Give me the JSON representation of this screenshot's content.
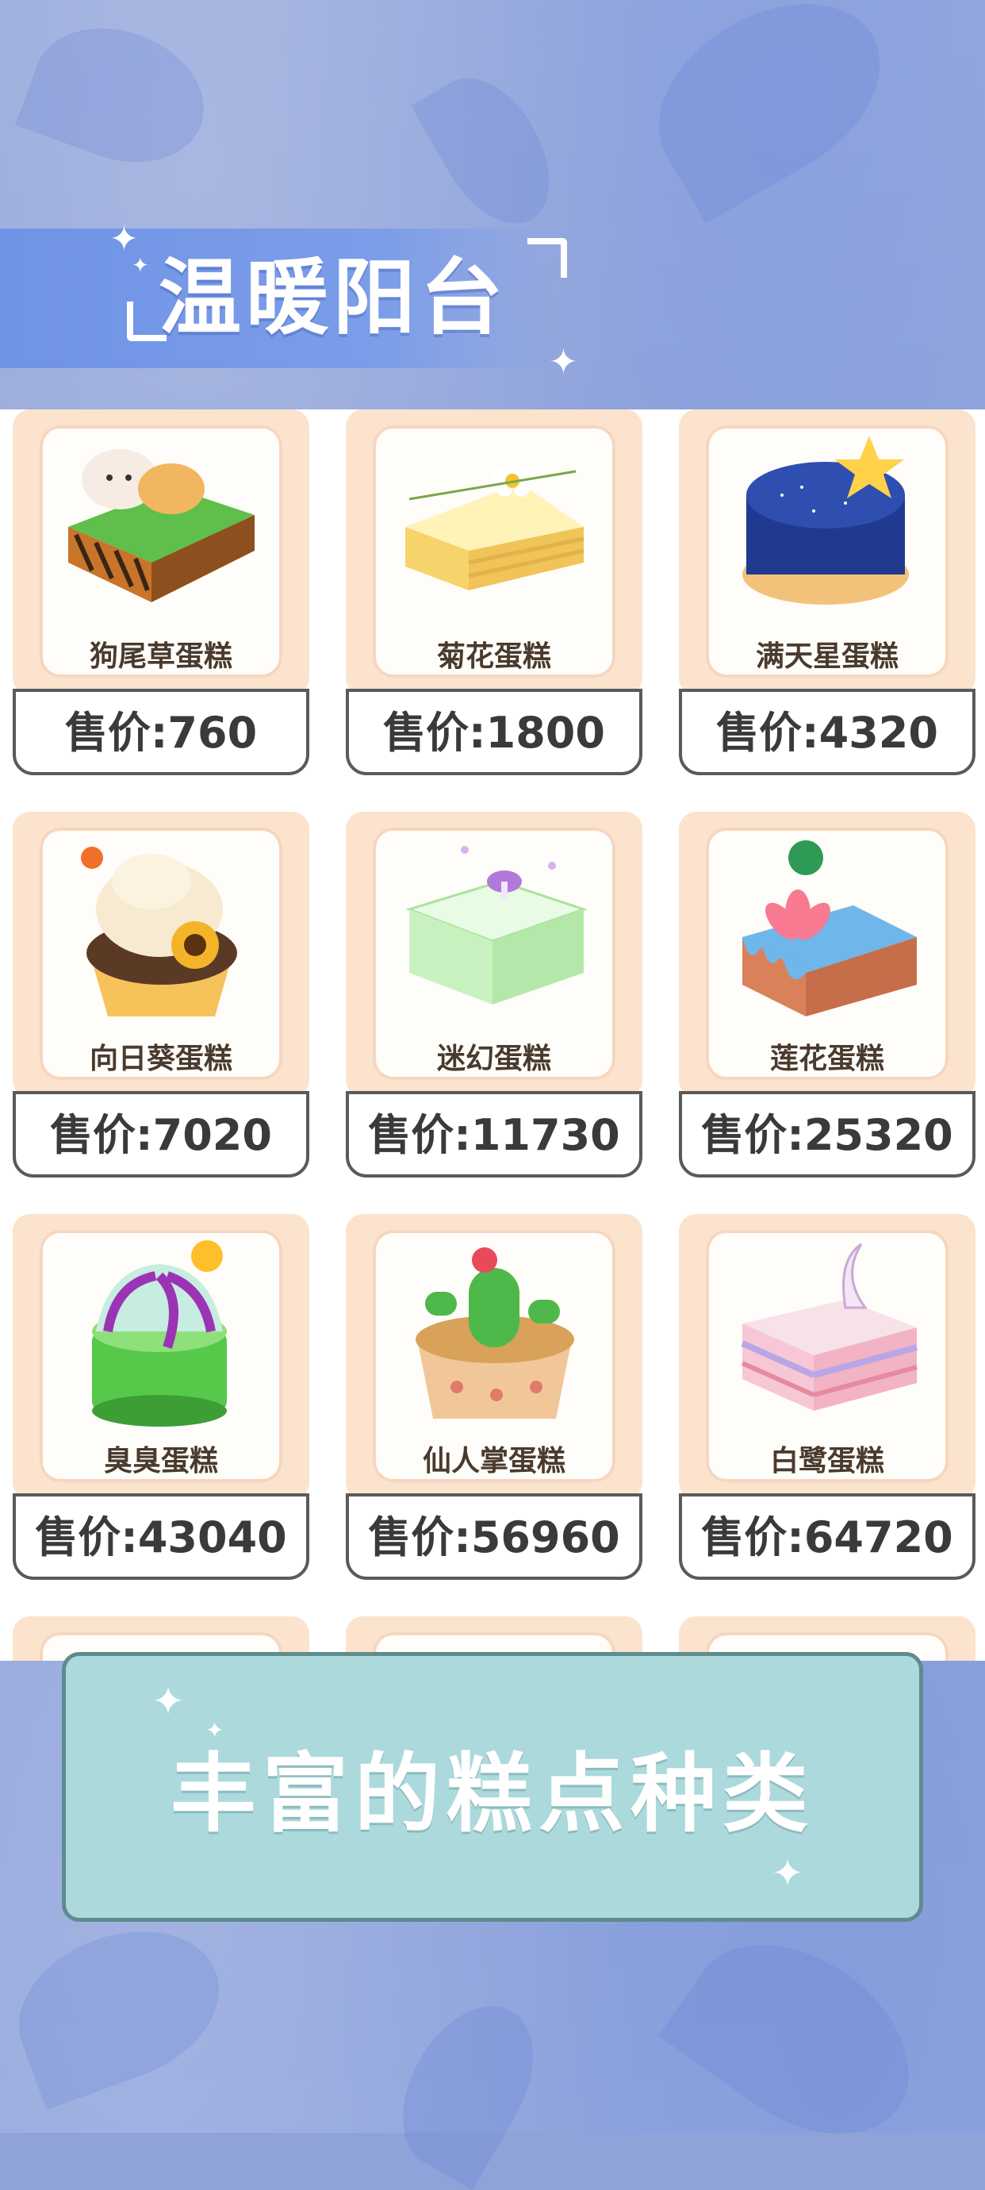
{
  "header": {
    "title": "温暖阳台"
  },
  "cakes": [
    {
      "name": "狗尾草蛋糕",
      "price": "售价:760",
      "icon": "hamster-cake-icon"
    },
    {
      "name": "菊花蛋糕",
      "price": "售价:1800",
      "icon": "chrysanthemum-cake-icon"
    },
    {
      "name": "满天星蛋糕",
      "price": "售价:4320",
      "icon": "starry-cake-icon"
    },
    {
      "name": "向日葵蛋糕",
      "price": "售价:7020",
      "icon": "sunflower-cupcake-icon"
    },
    {
      "name": "迷幻蛋糕",
      "price": "售价:11730",
      "icon": "jelly-cake-icon"
    },
    {
      "name": "莲花蛋糕",
      "price": "售价:25320",
      "icon": "lotus-cake-icon"
    },
    {
      "name": "臭臭蛋糕",
      "price": "售价:43040",
      "icon": "purple-green-cake-icon"
    },
    {
      "name": "仙人掌蛋糕",
      "price": "售价:56960",
      "icon": "cactus-cupcake-icon"
    },
    {
      "name": "白鹭蛋糕",
      "price": "售价:64720",
      "icon": "egret-layer-cake-icon"
    }
  ],
  "footer": {
    "slogan": "丰富的糕点种类"
  },
  "colors": {
    "banner": "#6f93e6",
    "card_frame": "#fbe3cd",
    "bottom_panel": "#acd9dc",
    "price_border": "#5a5a5a"
  }
}
